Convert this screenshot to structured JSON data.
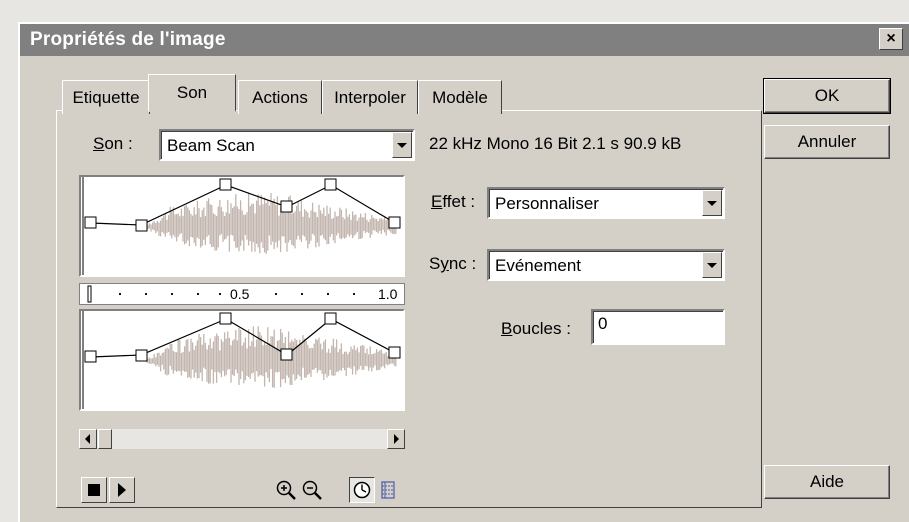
{
  "window": {
    "title": "Propriétés de l'image",
    "close_glyph": "×"
  },
  "tabs": [
    {
      "label": "Etiquette",
      "active": false
    },
    {
      "label": "Son",
      "active": true
    },
    {
      "label": "Actions",
      "active": false
    },
    {
      "label": "Interpoler",
      "active": false
    },
    {
      "label": "Modèle",
      "active": false
    }
  ],
  "sound": {
    "label_mnemonic": "S",
    "label_rest": "on :",
    "value": "Beam Scan",
    "info": "22 kHz Mono 16 Bit 2.1 s 90.9 kB"
  },
  "effect": {
    "label_mnemonic": "E",
    "label_rest": "ffet :",
    "value": "Personnaliser"
  },
  "sync": {
    "label_pre": "S",
    "label_mnemonic": "y",
    "label_rest": "nc :",
    "value": "Evénement"
  },
  "loops": {
    "label_mnemonic": "B",
    "label_rest": "oucles :",
    "value": "0"
  },
  "ruler": {
    "mid": "0.5",
    "end": "1.0"
  },
  "buttons": {
    "ok": "OK",
    "cancel": "Annuler",
    "help": "Aide"
  },
  "icons": {
    "stop": "stop-icon",
    "play": "play-icon",
    "zoom_in": "zoom-in-icon",
    "zoom_out": "zoom-out-icon",
    "time_units": "clock-icon",
    "frame_units": "frames-icon"
  },
  "colors": {
    "titlebar": "#808080",
    "face": "#d4d0c8",
    "wave": "#c2b5ad"
  }
}
